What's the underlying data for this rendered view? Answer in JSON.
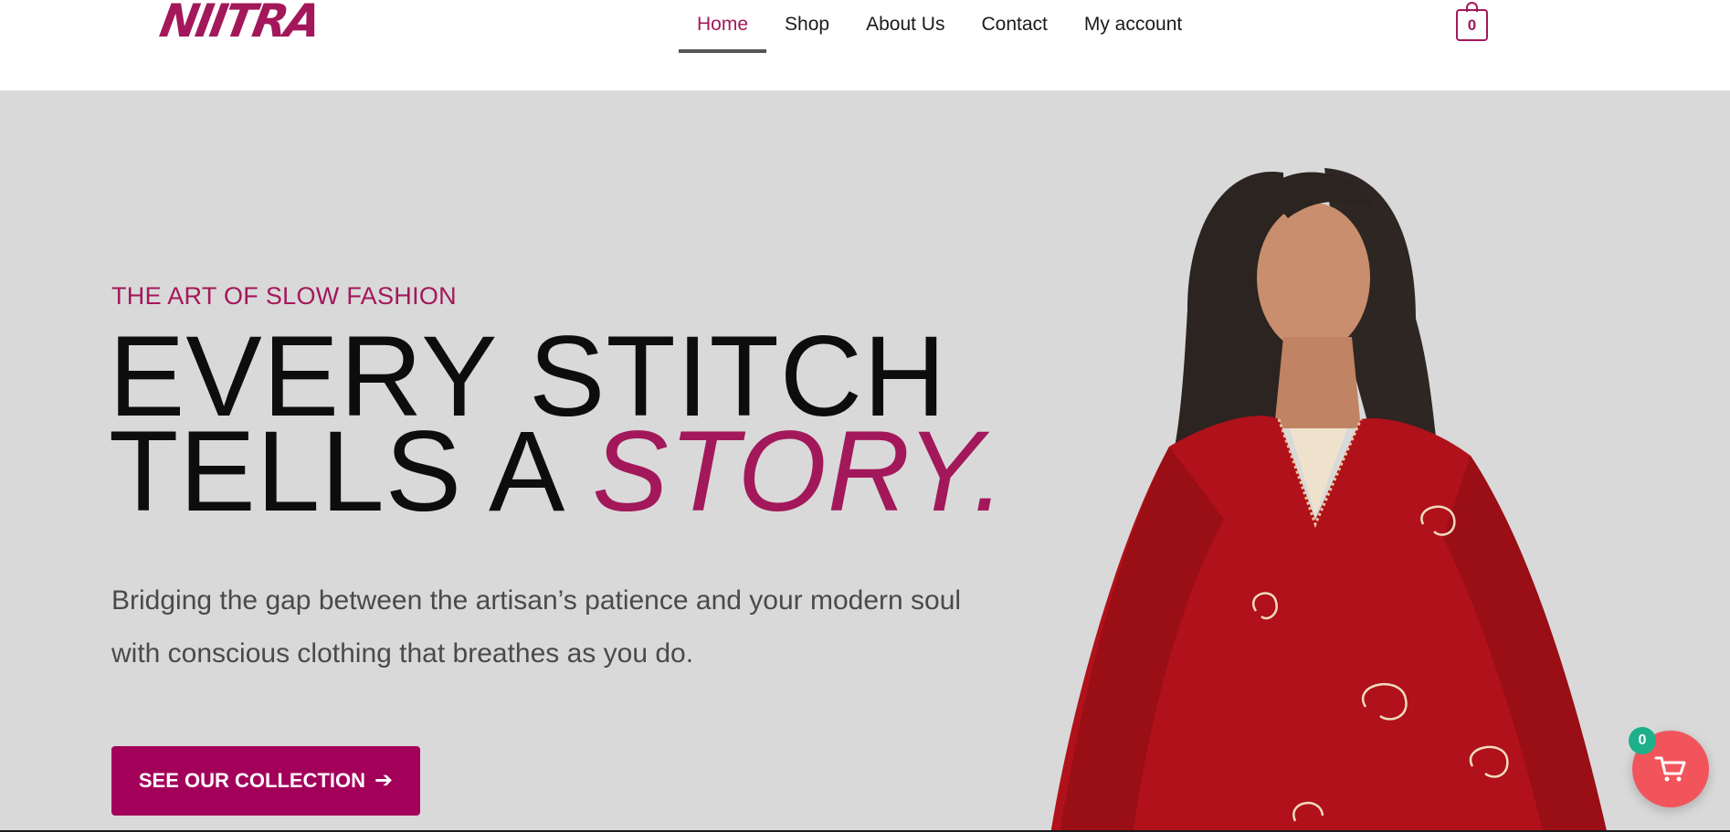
{
  "brand": {
    "logo_text": "NIITRA",
    "accent_color": "#a3185a"
  },
  "nav": {
    "items": [
      {
        "label": "Home",
        "active": true
      },
      {
        "label": "Shop",
        "active": false
      },
      {
        "label": "About Us",
        "active": false
      },
      {
        "label": "Contact",
        "active": false
      },
      {
        "label": "My account",
        "active": false
      }
    ]
  },
  "header_cart": {
    "icon": "shopping-bag-icon",
    "count": "0"
  },
  "hero": {
    "eyebrow": "THE ART OF SLOW FASHION",
    "headline_line1": "EVERY STITCH",
    "headline_line2_prefix": "TELLS A ",
    "headline_accent": "STORY.",
    "subtext": "Bridging the gap between the artisan’s patience and your modern soul with conscious clothing that breathes as you do.",
    "cta_label": "SEE OUR COLLECTION",
    "cta_icon": "arrow-right-icon",
    "background_color": "#d9d9d9"
  },
  "floating_cart": {
    "icon": "cart-icon",
    "count": "0",
    "color": "#f2545b",
    "badge_color": "#1db08a"
  }
}
